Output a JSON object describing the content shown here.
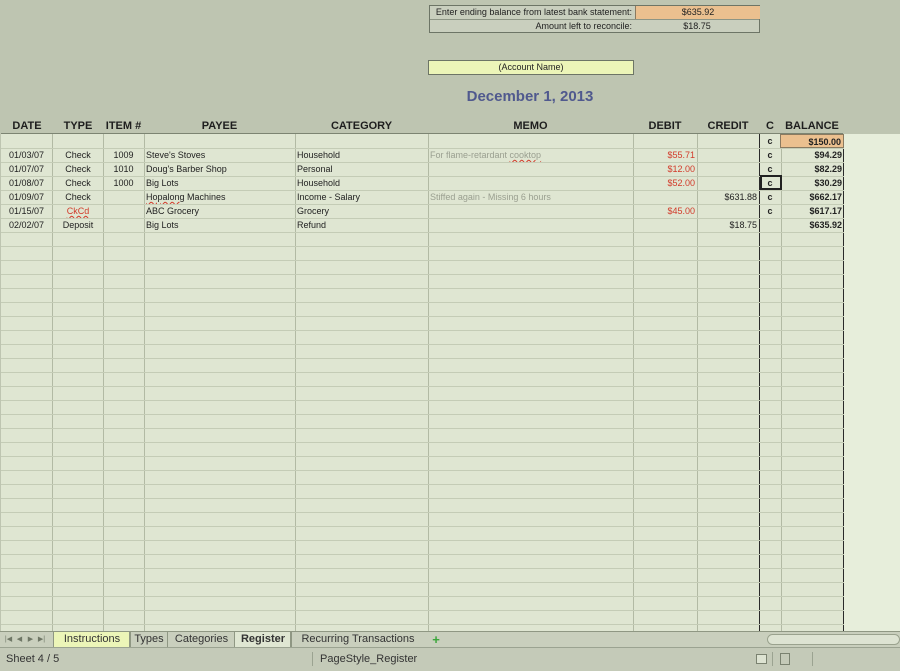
{
  "reconcile": {
    "ending_label": "Enter ending balance from latest bank statement:",
    "ending_value": "$635.92",
    "left_label": "Amount left to reconcile:",
    "left_value": "$18.75"
  },
  "account_name": "(Account Name)",
  "date_title": "December 1, 2013",
  "headers": {
    "date": "DATE",
    "type": "TYPE",
    "item": "ITEM #",
    "payee": "PAYEE",
    "category": "CATEGORY",
    "memo": "MEMO",
    "debit": "DEBIT",
    "credit": "CREDIT",
    "c": "C",
    "balance": "BALANCE"
  },
  "start_row": {
    "c": "c",
    "balance": "$150.00"
  },
  "rows": [
    {
      "date": "01/03/07",
      "type": "Check",
      "item": "1009",
      "payee": "Steve's Stoves",
      "category": "Household",
      "memo": "For flame-retardant cooktop",
      "debit": "$55.71",
      "credit": "",
      "c": "c",
      "balance": "$94.29"
    },
    {
      "date": "01/07/07",
      "type": "Check",
      "item": "1010",
      "payee": "Doug's Barber Shop",
      "category": "Personal",
      "memo": "",
      "debit": "$12.00",
      "credit": "",
      "c": "c",
      "balance": "$82.29"
    },
    {
      "date": "01/08/07",
      "type": "Check",
      "item": "1000",
      "payee": "Big Lots",
      "category": "Household",
      "memo": "",
      "debit": "$52.00",
      "credit": "",
      "c": "c",
      "balance": "$30.29"
    },
    {
      "date": "01/09/07",
      "type": "Check",
      "item": "",
      "payee": "Hopalong Machines",
      "category": "Income - Salary",
      "memo": "Stiffed again - Missing 6 hours",
      "debit": "",
      "credit": "$631.88",
      "c": "c",
      "balance": "$662.17"
    },
    {
      "date": "01/15/07",
      "type": "CkCd",
      "item": "",
      "payee": "ABC Grocery",
      "category": "Grocery",
      "memo": "",
      "debit": "$45.00",
      "credit": "",
      "c": "c",
      "balance": "$617.17"
    },
    {
      "date": "02/02/07",
      "type": "Deposit",
      "item": "",
      "payee": "Big Lots",
      "category": "Refund",
      "memo": "",
      "debit": "",
      "credit": "$18.75",
      "c": "",
      "balance": "$635.92"
    }
  ],
  "tabs": [
    "Instructions",
    "Types",
    "Categories",
    "Register",
    "Recurring Transactions"
  ],
  "active_tab": "Register",
  "status": {
    "sheet": "Sheet 4 / 5",
    "page_style": "PageStyle_Register"
  },
  "icons": {
    "add_sheet": "plus-icon",
    "nav": [
      "first-sheet-icon",
      "prev-sheet-icon",
      "next-sheet-icon",
      "last-sheet-icon"
    ]
  },
  "colors": {
    "input_cell": "#ebc08f",
    "account_cell": "#ecf5b8",
    "title": "#50598e",
    "debit": "#d23a2a"
  }
}
